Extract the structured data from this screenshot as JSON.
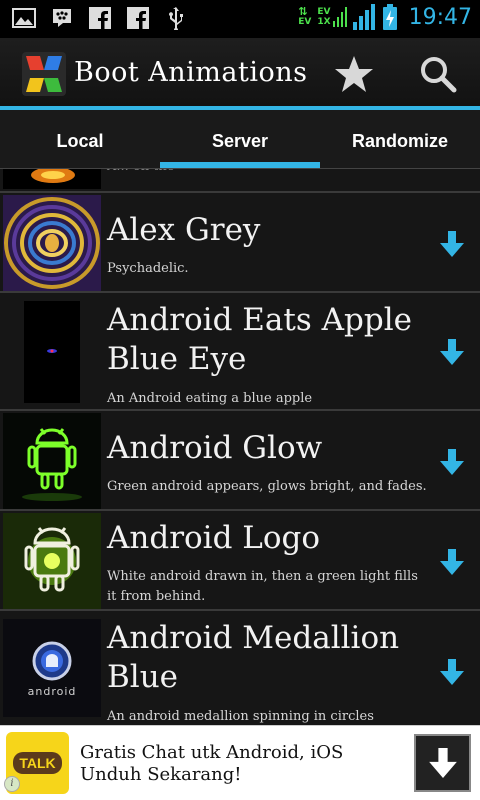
{
  "status_bar": {
    "time": "19:47",
    "left_icons": [
      "image-notification-icon",
      "bbm-icon",
      "facebook-icon",
      "facebook-icon",
      "usb-icon"
    ],
    "right_icons": [
      "data-ev-icon",
      "signal-ev-icon",
      "signal-bars-icon",
      "battery-charging-icon"
    ],
    "data_label_top": "EV",
    "data_label_mid": "EV",
    "data_label_bottom": "1X"
  },
  "action_bar": {
    "title": "Boot Animations",
    "star_icon": "star-icon",
    "search_icon": "search-icon"
  },
  "tabs": [
    {
      "label": "Local"
    },
    {
      "label": "Server"
    },
    {
      "label": "Randomize"
    }
  ],
  "active_tab": "Server",
  "list": {
    "partial_top_desc": "A... on the",
    "items": [
      {
        "title": "Alex Grey",
        "description": "Psychadelic."
      },
      {
        "title": "Android Eats Apple Blue Eye",
        "description": "An Android eating a blue apple"
      },
      {
        "title": "Android Glow",
        "description": "Green android appears, glows bright, and fades."
      },
      {
        "title": "Android Logo",
        "description": "White android drawn in, then a green light fills it from behind."
      },
      {
        "title": "Android Medallion Blue",
        "description": "An android medallion spinning in circles"
      }
    ],
    "medallion_word": "android"
  },
  "ad": {
    "logo_text": "TALK",
    "text": "Gratis Chat utk Android, iOS Unduh Sekarang!",
    "button_icon": "download-arrow-icon",
    "info_icon": "i"
  },
  "colors": {
    "accent": "#33b5e5",
    "background": "#111111",
    "ad_logo": "#f6d51a"
  }
}
